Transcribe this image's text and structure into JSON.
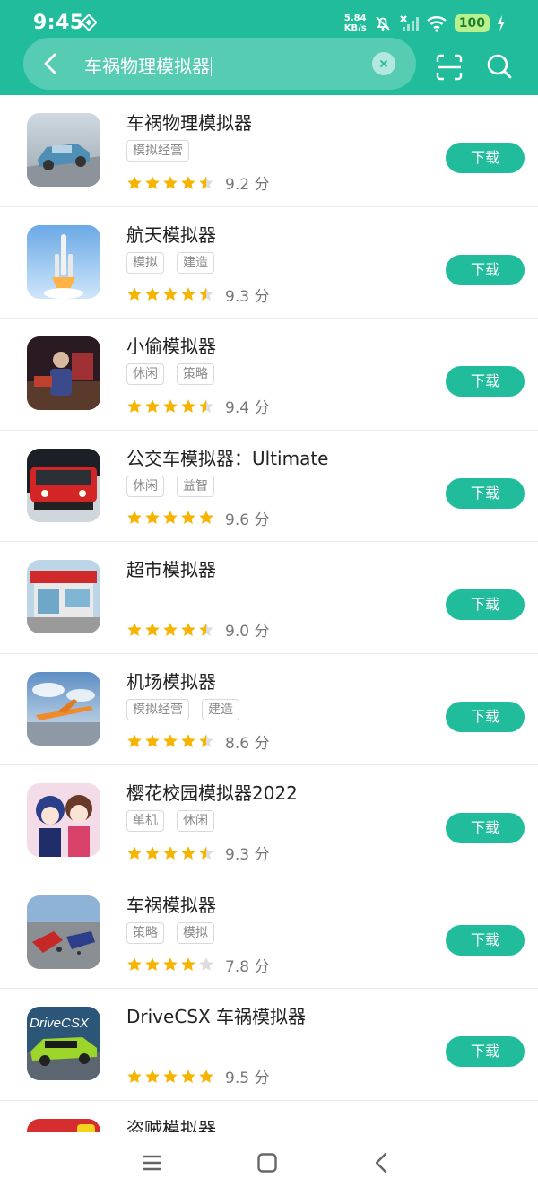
{
  "status_bar": {
    "time": "9:45",
    "net_speed": "5.84",
    "net_unit": "KB/s",
    "battery": "100"
  },
  "search": {
    "query": "车祸物理模拟器"
  },
  "colors": {
    "accent": "#21bc9c",
    "star": "#f6b400",
    "star_empty": "#dcdcdc"
  },
  "download_label": "下载",
  "score_unit": "分",
  "apps": [
    {
      "name": "车祸物理模拟器",
      "tags": [
        "模拟经营"
      ],
      "rating": 4.5,
      "score": "9.2"
    },
    {
      "name": "航天模拟器",
      "tags": [
        "模拟",
        "建造"
      ],
      "rating": 4.5,
      "score": "9.3"
    },
    {
      "name": "小偷模拟器",
      "tags": [
        "休闲",
        "策略"
      ],
      "rating": 4.5,
      "score": "9.4"
    },
    {
      "name": "公交车模拟器：Ultimate",
      "tags": [
        "休闲",
        "益智"
      ],
      "rating": 5,
      "score": "9.6"
    },
    {
      "name": "超市模拟器",
      "tags": [],
      "rating": 4.5,
      "score": "9.0"
    },
    {
      "name": "机场模拟器",
      "tags": [
        "模拟经营",
        "建造"
      ],
      "rating": 4.5,
      "score": "8.6"
    },
    {
      "name": "樱花校园模拟器2022",
      "tags": [
        "单机",
        "休闲"
      ],
      "rating": 4.5,
      "score": "9.3"
    },
    {
      "name": "车祸模拟器",
      "tags": [
        "策略",
        "模拟"
      ],
      "rating": 4,
      "score": "7.8"
    },
    {
      "name": "DriveCSX 车祸模拟器",
      "tags": [],
      "rating": 5,
      "score": "9.5",
      "icon_text": "DriveCSX"
    },
    {
      "name": "盗贼模拟器",
      "tags": [],
      "rating": null,
      "score": null
    }
  ]
}
